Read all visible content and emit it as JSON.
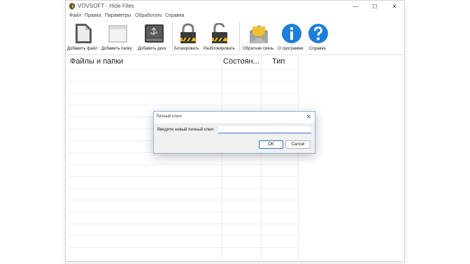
{
  "window": {
    "title": "VOVSOFT - Hide Files",
    "controls": {
      "minimize": "—",
      "maximize": "☐",
      "close": "✕"
    }
  },
  "menu": [
    "Файл",
    "Правка",
    "Параметры",
    "Обработать",
    "Справка"
  ],
  "toolbar": {
    "add_file": "Добавить файл",
    "add_folder": "Добавить папку",
    "add_disk": "Добавить диск",
    "lock": "Блокировать",
    "unlock": "Разблокировать",
    "feedback": "Обратная связь",
    "about": "О программе",
    "help": "Справка"
  },
  "icons": {
    "add_file": "file-icon",
    "add_folder": "folder-icon",
    "add_disk": "usb-drive-icon",
    "lock": "padlock-closed-icon",
    "unlock": "padlock-open-icon",
    "feedback": "envelope-icon",
    "about": "info-icon",
    "help": "question-icon"
  },
  "columns": [
    "Файлы и папки",
    "Состоян...",
    "Тип"
  ],
  "dialog": {
    "title": "Личный ключ",
    "close": "✕",
    "prompt": "Введите новый личный ключ:",
    "input_value": "",
    "ok": "OK",
    "cancel": "Cancel"
  },
  "colors": {
    "accent_blue": "#1e7fd8",
    "envelope_yellow": "#f2c12e",
    "dialog_border": "#8fb4d9"
  }
}
